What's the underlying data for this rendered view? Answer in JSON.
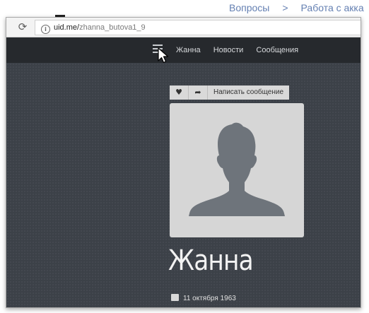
{
  "background": {
    "crumb1": "Вопросы",
    "separator": ">",
    "crumb2": "Работа с акка"
  },
  "browser": {
    "url_host": "uid.me/",
    "url_path": "zhanna_butova1_9"
  },
  "nav": {
    "links": [
      "Жанна",
      "Новости",
      "Сообщения"
    ]
  },
  "actions": {
    "message_label": "Написать сообщение"
  },
  "profile": {
    "name": "Жанна",
    "birthdate": "11 октября 1963"
  },
  "colors": {
    "page_bg": "#3c4148",
    "nav_bg": "#26292d",
    "avatar_bg": "#d6d6d6",
    "silhouette": "#6e747b"
  }
}
